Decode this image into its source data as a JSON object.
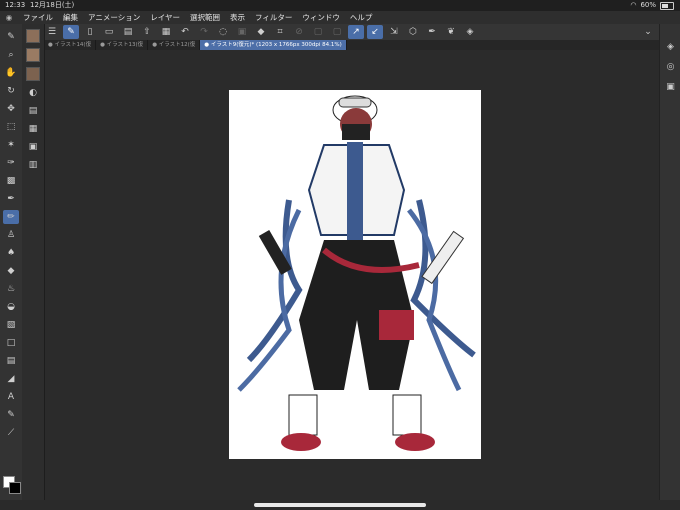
{
  "status_bar": {
    "time": "12:33",
    "date": "12月18日(土)",
    "battery": "60%"
  },
  "menu": {
    "items": [
      "ファイル",
      "編集",
      "アニメーション",
      "レイヤー",
      "選択範囲",
      "表示",
      "フィルター",
      "ウィンドウ",
      "ヘルプ"
    ]
  },
  "tabs": [
    {
      "label": "● イラスト14(復"
    },
    {
      "label": "● イラスト13(復"
    },
    {
      "label": "● イラスト12(復"
    },
    {
      "label": "● イラスト9(復元)* (1203 x 1766px 300dpi 84.1%)"
    }
  ],
  "colors": {
    "accent": "#4a6ea8",
    "canvas": "#ffffff",
    "background": "#2b2b2b"
  },
  "icons": {
    "toolbar": [
      "menu-icon",
      "pen-settings-icon",
      "new-file-icon",
      "open-folder-icon",
      "save-icon",
      "upload-icon",
      "print-icon",
      "undo-icon",
      "redo-icon",
      "lasso-icon",
      "fill-icon",
      "transform-icon",
      "crop-icon",
      "snap-icon",
      "ruler-icon",
      "pen-icon",
      "eraser-icon",
      "layer-icon",
      "brush-icon",
      "fill-bucket-icon",
      "palette-icon"
    ]
  }
}
